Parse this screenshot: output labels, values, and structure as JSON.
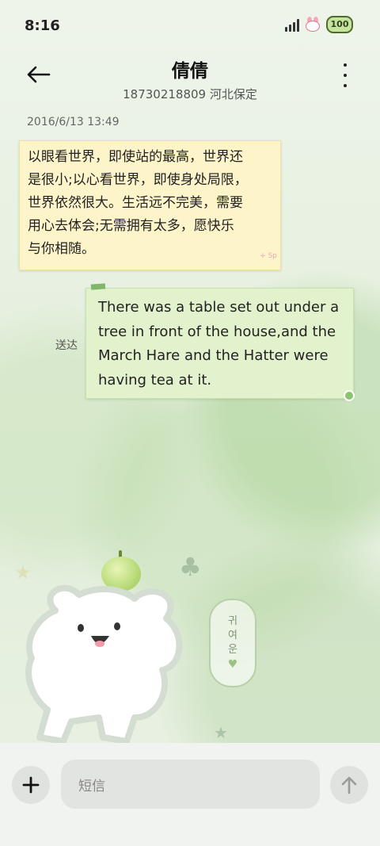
{
  "status_bar": {
    "time": "8:16",
    "battery": "100"
  },
  "header": {
    "contact_name": "倩倩",
    "contact_subtitle": "18730218809 河北保定",
    "back_icon": "arrow-left-icon",
    "more_icon": "more-vertical-icon"
  },
  "conversation": {
    "timestamp": "2016/6/13 13:49",
    "messages": [
      {
        "direction": "incoming",
        "lines": [
          "以眼看世界，即使站的最高，世界还",
          "是很小;以心看世界，即使身处局限，",
          "世界依然很大。生活远不完美，需要",
          "用心去体会;无需拥有太多，愿快乐",
          "与你相随。"
        ],
        "signature": "+ Sp"
      },
      {
        "direction": "outgoing",
        "status": "送达",
        "lines": [
          "There was a table set out under a",
          "tree in front of the house,and the",
          "March Hare and the Hatter were",
          "having tea at it."
        ]
      }
    ]
  },
  "decoration": {
    "tag_text": [
      "귀",
      "여",
      "운"
    ]
  },
  "composer": {
    "placeholder": "短信",
    "add_icon": "plus-icon",
    "send_icon": "arrow-up-icon"
  },
  "colors": {
    "incoming_bubble": "#fdf4c9",
    "outgoing_bubble": "#e1f2cd",
    "background": "#e6efe0"
  }
}
